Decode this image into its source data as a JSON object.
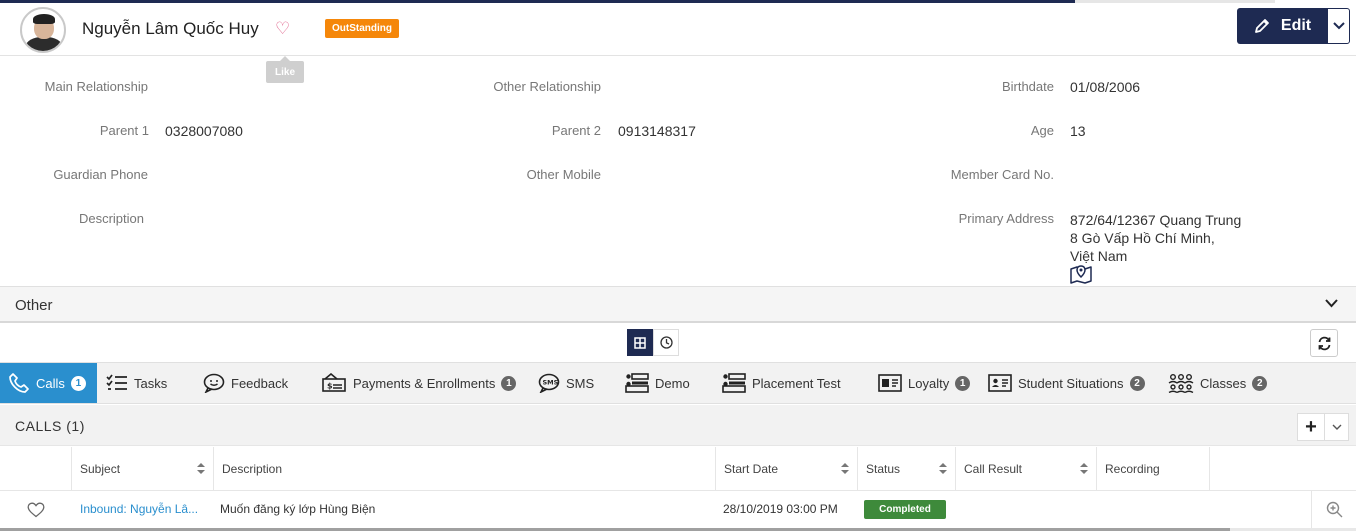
{
  "header": {
    "name": "Nguyễn Lâm Quốc Huy",
    "badge": "OutStanding",
    "like_tooltip": "Like",
    "edit_label": "Edit"
  },
  "fields": {
    "main_relationship": {
      "label": "Main Relationship",
      "value": ""
    },
    "other_relationship": {
      "label": "Other Relationship",
      "value": ""
    },
    "birthdate": {
      "label": "Birthdate",
      "value": "01/08/2006"
    },
    "parent1": {
      "label": "Parent 1",
      "value": "0328007080"
    },
    "parent2": {
      "label": "Parent 2",
      "value": "0913148317"
    },
    "age": {
      "label": "Age",
      "value": "13"
    },
    "guardian_phone": {
      "label": "Guardian Phone",
      "value": ""
    },
    "other_mobile": {
      "label": "Other Mobile",
      "value": ""
    },
    "member_card": {
      "label": "Member Card No.",
      "value": ""
    },
    "description": {
      "label": "Description",
      "value": ""
    },
    "primary_address": {
      "label": "Primary Address",
      "lines": [
        "872/64/12367 Quang Trung",
        "8 Gò Vấp Hồ Chí Minh,",
        "Việt Nam"
      ]
    }
  },
  "other_section": {
    "title": "Other"
  },
  "tabs": [
    {
      "label": "Calls",
      "count": "1",
      "icon": "phone-icon",
      "active": true
    },
    {
      "label": "Tasks",
      "count": "",
      "icon": "tasks-icon"
    },
    {
      "label": "Feedback",
      "count": "",
      "icon": "feedback-icon"
    },
    {
      "label": "Payments & Enrollments",
      "count": "1",
      "icon": "payment-icon"
    },
    {
      "label": "SMS",
      "count": "",
      "icon": "sms-icon"
    },
    {
      "label": "Demo",
      "count": "",
      "icon": "demo-icon"
    },
    {
      "label": "Placement Test",
      "count": "",
      "icon": "placement-test-icon"
    },
    {
      "label": "Loyalty",
      "count": "1",
      "icon": "loyalty-icon"
    },
    {
      "label": "Student Situations",
      "count": "2",
      "icon": "id-card-icon"
    },
    {
      "label": "Classes",
      "count": "2",
      "icon": "classes-icon"
    }
  ],
  "calls": {
    "title": "CALLS",
    "count": "(1)",
    "columns": [
      "Subject",
      "Description",
      "Start Date",
      "Status",
      "Call Result",
      "Recording"
    ],
    "rows": [
      {
        "subject": "Inbound: Nguyễn Lâ...",
        "description": "Muốn đăng ký lớp Hùng Biện",
        "start_date": "28/10/2019 03:00 PM",
        "status": "Completed",
        "call_result": "",
        "recording": ""
      }
    ]
  },
  "colors": {
    "primary": "#1e2a52",
    "accent": "#2a8fce",
    "badge": "#f5870a",
    "completed": "#3e8a3b",
    "heart": "#e0638b"
  }
}
